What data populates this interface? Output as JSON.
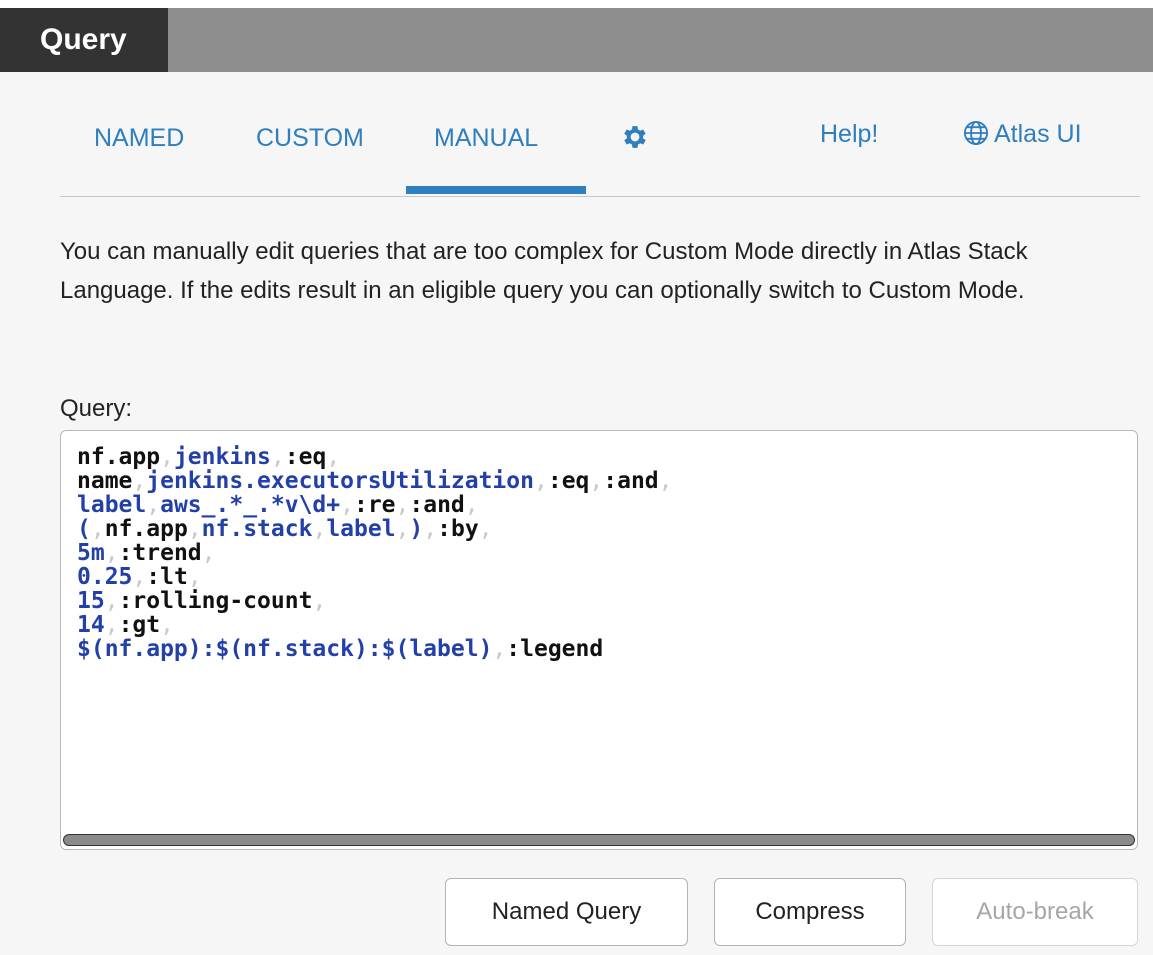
{
  "header": {
    "title": "Query"
  },
  "tabs": {
    "named": "NAMED",
    "custom": "CUSTOM",
    "manual": "MANUAL",
    "settings_icon": "gear-icon",
    "help": "Help!",
    "atlas_icon": "globe-icon",
    "atlas": "Atlas UI",
    "active": "MANUAL"
  },
  "description": "You can manually edit queries that are too complex for Custom Mode directly in Atlas Stack Language. If the edits result in an eligible query you can optionally switch to Custom Mode.",
  "query": {
    "label": "Query:",
    "lines": [
      [
        [
          "w",
          "nf.app"
        ],
        [
          "c",
          ","
        ],
        [
          "v",
          "jenkins"
        ],
        [
          "c",
          ","
        ],
        [
          "w",
          ":eq"
        ],
        [
          "c",
          ","
        ]
      ],
      [
        [
          "w",
          "name"
        ],
        [
          "c",
          ","
        ],
        [
          "v",
          "jenkins.executorsUtilization"
        ],
        [
          "c",
          ","
        ],
        [
          "w",
          ":eq"
        ],
        [
          "c",
          ","
        ],
        [
          "w",
          ":and"
        ],
        [
          "c",
          ","
        ]
      ],
      [
        [
          "v",
          "label"
        ],
        [
          "c",
          ","
        ],
        [
          "v",
          "aws_.*_.*v\\d+"
        ],
        [
          "c",
          ","
        ],
        [
          "w",
          ":re"
        ],
        [
          "c",
          ","
        ],
        [
          "w",
          ":and"
        ],
        [
          "c",
          ","
        ]
      ],
      [
        [
          "v",
          "("
        ],
        [
          "c",
          ","
        ],
        [
          "w",
          "nf.app"
        ],
        [
          "c",
          ","
        ],
        [
          "v",
          "nf.stack"
        ],
        [
          "c",
          ","
        ],
        [
          "v",
          "label"
        ],
        [
          "c",
          ","
        ],
        [
          "v",
          ")"
        ],
        [
          "c",
          ","
        ],
        [
          "w",
          ":by"
        ],
        [
          "c",
          ","
        ]
      ],
      [
        [
          "v",
          "5m"
        ],
        [
          "c",
          ","
        ],
        [
          "w",
          ":trend"
        ],
        [
          "c",
          ","
        ]
      ],
      [
        [
          "v",
          "0.25"
        ],
        [
          "c",
          ","
        ],
        [
          "w",
          ":lt"
        ],
        [
          "c",
          ","
        ]
      ],
      [
        [
          "v",
          "15"
        ],
        [
          "c",
          ","
        ],
        [
          "w",
          ":rolling-count"
        ],
        [
          "c",
          ","
        ]
      ],
      [
        [
          "v",
          "14"
        ],
        [
          "c",
          ","
        ],
        [
          "w",
          ":gt"
        ],
        [
          "c",
          ","
        ]
      ],
      [
        [
          "v",
          "$(nf.app):$(nf.stack):$(label)"
        ],
        [
          "c",
          ","
        ],
        [
          "w",
          ":legend"
        ]
      ]
    ]
  },
  "buttons": {
    "named_query": "Named Query",
    "compress": "Compress",
    "auto_break": "Auto-break"
  },
  "colors": {
    "accent": "#2f7ebd",
    "header_bg": "#333333",
    "header_bar": "#8e8e8e",
    "code_value": "#2340a8",
    "code_comma": "#c8c8c8"
  }
}
